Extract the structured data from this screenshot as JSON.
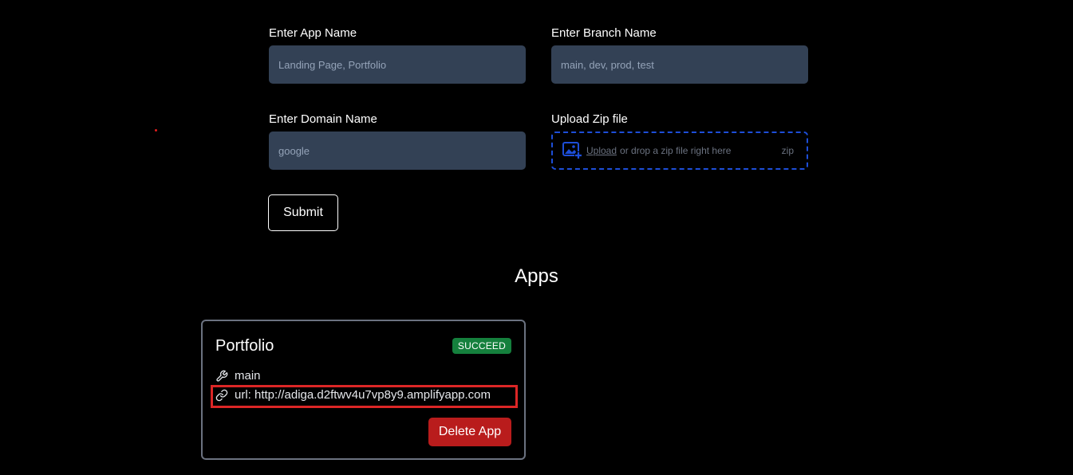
{
  "form": {
    "app_name": {
      "label": "Enter App Name",
      "placeholder": "Landing Page, Portfolio"
    },
    "branch_name": {
      "label": "Enter Branch Name",
      "placeholder": "main, dev, prod, test"
    },
    "domain_name": {
      "label": "Enter Domain Name",
      "placeholder": "google"
    },
    "upload": {
      "label": "Upload Zip file",
      "link_text": "Upload",
      "text": "or drop a zip file right here",
      "ext": "zip",
      "icon": "image-add-icon",
      "accent": "#1d4ed8"
    },
    "submit_label": "Submit"
  },
  "apps": {
    "heading": "Apps",
    "items": [
      {
        "name": "Portfolio",
        "status": "SUCCEED",
        "status_color": "#15803d",
        "branch": "main",
        "branch_icon": "wrench-icon",
        "url_text": "url: http://adiga.d2ftwv4u7vp8y9.amplifyapp.com",
        "url_icon": "link-icon",
        "delete_label": "Delete App",
        "delete_color": "#b91c1c",
        "highlight_color": "#dc2626"
      }
    ]
  }
}
